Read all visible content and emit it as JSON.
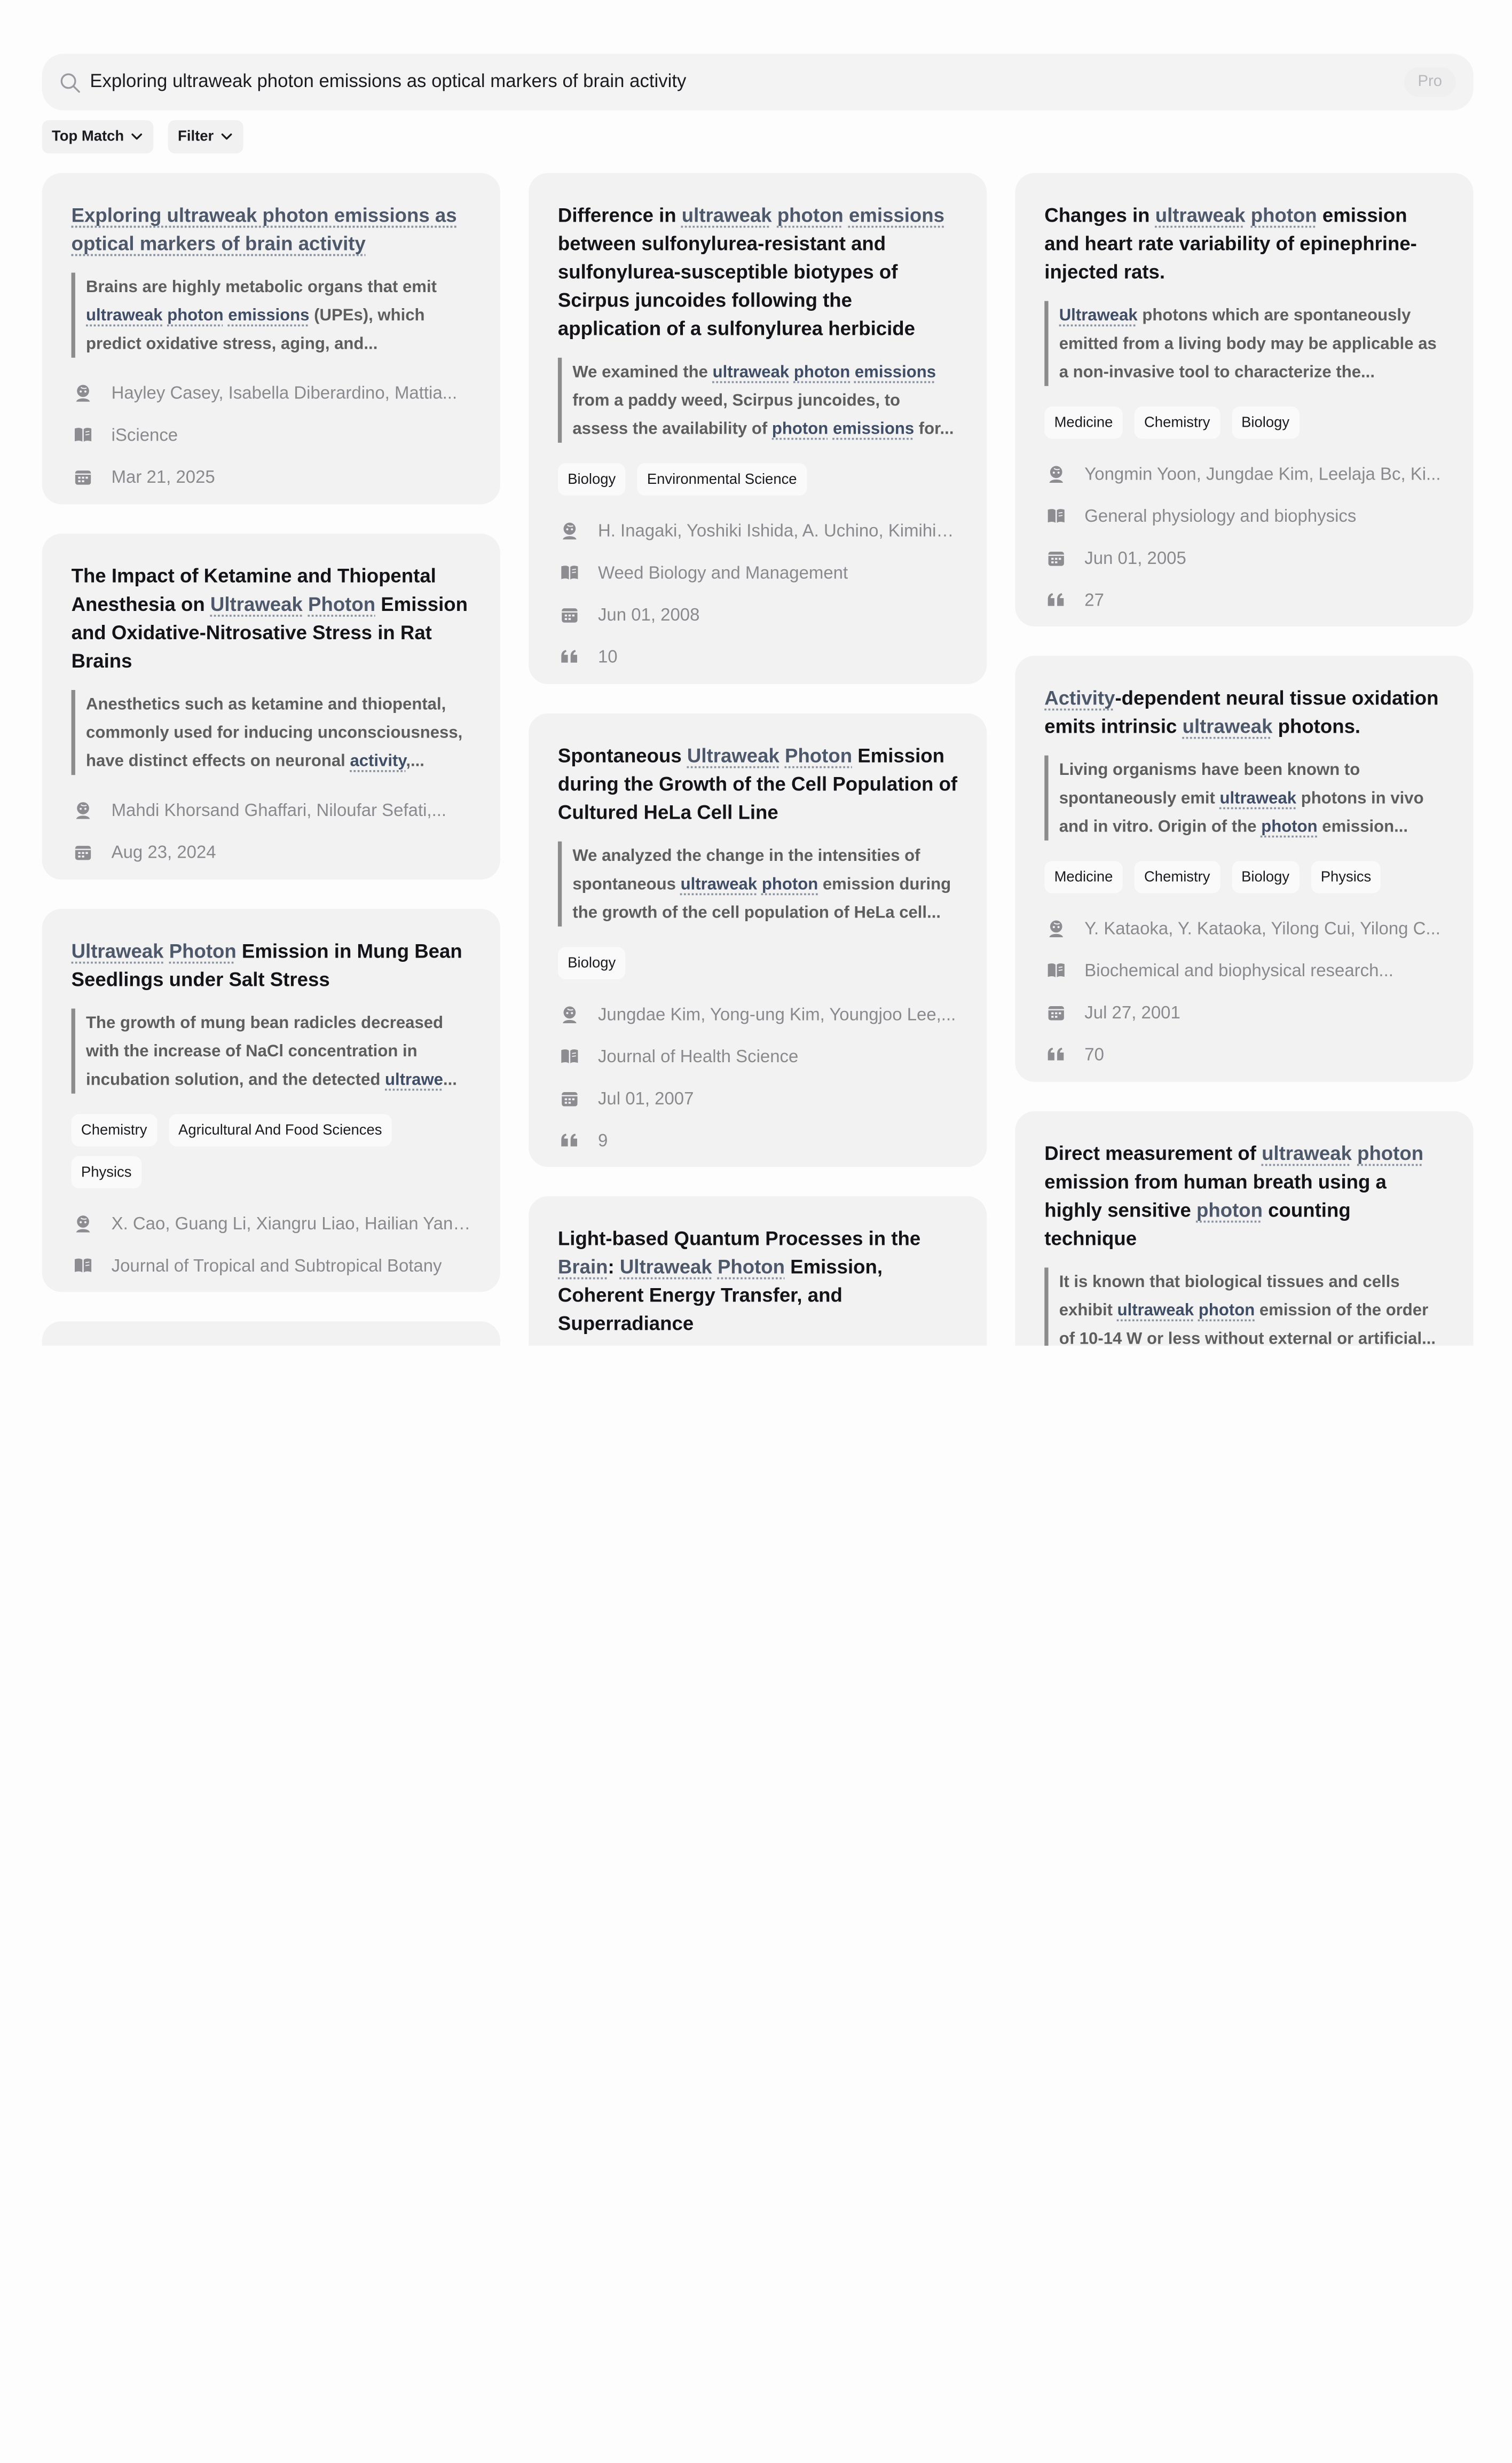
{
  "search": {
    "query": "Exploring ultraweak photon emissions as optical markers of brain activity",
    "pro_label": "Pro"
  },
  "controls": {
    "sort_label": "Top Match",
    "filter_label": "Filter"
  },
  "cards": [
    {
      "title_parts": [
        {
          "t": "Exploring ultraweak photon emissions as optical markers of brain activity",
          "h": true
        }
      ],
      "title_link": true,
      "abstract_parts": [
        {
          "t": "Brains are highly metabolic organs that emit "
        },
        {
          "t": "ultraweak",
          "h": true
        },
        {
          "t": " "
        },
        {
          "t": "photon",
          "h": true
        },
        {
          "t": " "
        },
        {
          "t": "emissions",
          "h": true
        },
        {
          "t": " (UPEs), which predict oxidative stress, aging, and..."
        }
      ],
      "tags": [],
      "authors": "Hayley Casey, Isabella Diberardino, Mattia...",
      "journal": "iScience",
      "date": "Mar 21, 2025",
      "citations": null
    },
    {
      "title_parts": [
        {
          "t": "The Impact of Ketamine and Thiopental Anesthesia on "
        },
        {
          "t": "Ultraweak",
          "h": true
        },
        {
          "t": " "
        },
        {
          "t": "Photon",
          "h": true
        },
        {
          "t": " Emission and Oxidative-Nitrosative Stress in Rat Brains"
        }
      ],
      "abstract_parts": [
        {
          "t": "Anesthetics such as ketamine and thiopental, commonly used for inducing unconsciousness, have distinct effects on neuronal "
        },
        {
          "t": "activity",
          "h": true
        },
        {
          "t": ",..."
        }
      ],
      "tags": [],
      "authors": "Mahdi Khorsand Ghaffari, Niloufar Sefati,...",
      "journal": null,
      "date": "Aug 23, 2024",
      "citations": null
    },
    {
      "title_parts": [
        {
          "t": "Ultraweak",
          "h": true
        },
        {
          "t": " "
        },
        {
          "t": "Photon",
          "h": true
        },
        {
          "t": " Emission in Mung Bean Seedlings under Salt Stress"
        }
      ],
      "abstract_parts": [
        {
          "t": "The growth of mung bean radicles decreased with the increase of NaCl concentration in incubation solution, and the detected "
        },
        {
          "t": "ultrawe",
          "h": true
        },
        {
          "t": "..."
        }
      ],
      "tags": [
        "Chemistry",
        "Agricultural And Food Sciences",
        "Physics"
      ],
      "authors": "X. Cao, Guang Li, Xiangru Liao, Hailian Yang...",
      "journal": "Journal of Tropical and Subtropical Botany",
      "date": null,
      "citations": null
    },
    {
      "title_parts": [
        {
          "t": "Difference in "
        },
        {
          "t": "ultraweak",
          "h": true
        },
        {
          "t": " "
        },
        {
          "t": "photon",
          "h": true
        },
        {
          "t": " "
        },
        {
          "t": "emissions",
          "h": true
        },
        {
          "t": " between sulfonylurea-resistant and sulfonylurea-susceptible biotypes of Scirpus juncoides following the application of a sulfonylurea herbicide"
        }
      ],
      "abstract_parts": [
        {
          "t": "We examined the "
        },
        {
          "t": "ultraweak",
          "h": true
        },
        {
          "t": " "
        },
        {
          "t": "photon",
          "h": true
        },
        {
          "t": " "
        },
        {
          "t": "emissions",
          "h": true
        },
        {
          "t": " from a paddy weed, Scirpus juncoides, to assess the availability of "
        },
        {
          "t": "photon",
          "h": true
        },
        {
          "t": " "
        },
        {
          "t": "emissions",
          "h": true
        },
        {
          "t": " for..."
        }
      ],
      "tags": [
        "Biology",
        "Environmental Science"
      ],
      "authors": "H. Inagaki, Yoshiki Ishida, A. Uchino, Kimihik...",
      "journal": "Weed Biology and Management",
      "date": "Jun 01, 2008",
      "citations": "10"
    },
    {
      "title_parts": [
        {
          "t": "Spontaneous "
        },
        {
          "t": "Ultraweak",
          "h": true
        },
        {
          "t": " "
        },
        {
          "t": "Photon",
          "h": true
        },
        {
          "t": " Emission during the Growth of the Cell Population of Cultured HeLa Cell Line"
        }
      ],
      "abstract_parts": [
        {
          "t": "We analyzed the change in the intensities of spontaneous "
        },
        {
          "t": "ultraweak",
          "h": true
        },
        {
          "t": " "
        },
        {
          "t": "photon",
          "h": true
        },
        {
          "t": " emission during the growth of the cell population of HeLa cell..."
        }
      ],
      "tags": [
        "Biology"
      ],
      "authors": "Jungdae Kim, Yong-ung Kim, Youngjoo Lee,...",
      "journal": "Journal of Health Science",
      "date": "Jul 01, 2007",
      "citations": "9"
    },
    {
      "title_parts": [
        {
          "t": "Light-based Quantum Processes in the "
        },
        {
          "t": "Brain",
          "h": true
        },
        {
          "t": ": "
        },
        {
          "t": "Ultraweak",
          "h": true
        },
        {
          "t": " "
        },
        {
          "t": "Photon",
          "h": true
        },
        {
          "t": " Emission, Coherent Energy Transfer, and Superradiance"
        }
      ],
      "abstract_parts": null,
      "tags": [],
      "authors": null,
      "journal": null,
      "date": null,
      "citations": null
    },
    {
      "title_parts": [
        {
          "t": "Changes in "
        },
        {
          "t": "ultraweak",
          "h": true
        },
        {
          "t": " "
        },
        {
          "t": "photon",
          "h": true
        },
        {
          "t": " emission and heart rate variability of epinephrine-injected rats."
        }
      ],
      "abstract_parts": [
        {
          "t": "Ultraweak",
          "h": true
        },
        {
          "t": " photons which are spontaneously emitted from a living body may be applicable as a non-invasive tool to characterize the..."
        }
      ],
      "tags": [
        "Medicine",
        "Chemistry",
        "Biology"
      ],
      "authors": "Yongmin Yoon, Jungdae Kim, Leelaja Bc, Ki...",
      "journal": "General physiology and biophysics",
      "date": "Jun 01, 2005",
      "citations": "27"
    },
    {
      "title_parts": [
        {
          "t": "Activity",
          "h": true
        },
        {
          "t": "-dependent neural tissue oxidation emits intrinsic "
        },
        {
          "t": "ultraweak",
          "h": true
        },
        {
          "t": " photons."
        }
      ],
      "abstract_parts": [
        {
          "t": "Living organisms have been known to spontaneously emit "
        },
        {
          "t": "ultraweak",
          "h": true
        },
        {
          "t": " photons in vivo and in vitro. Origin of the "
        },
        {
          "t": "photon",
          "h": true
        },
        {
          "t": " emission..."
        }
      ],
      "tags": [
        "Medicine",
        "Chemistry",
        "Biology",
        "Physics"
      ],
      "authors": "Y. Kataoka, Y. Kataoka, Yilong Cui, Yilong C...",
      "journal": "Biochemical and biophysical research...",
      "date": "Jul 27, 2001",
      "citations": "70"
    },
    {
      "title_parts": [
        {
          "t": "Direct measurement of "
        },
        {
          "t": "ultraweak",
          "h": true
        },
        {
          "t": " "
        },
        {
          "t": "photon",
          "h": true
        },
        {
          "t": " emission from human breath using a highly sensitive "
        },
        {
          "t": "photon",
          "h": true
        },
        {
          "t": " counting technique"
        }
      ],
      "abstract_parts": [
        {
          "t": "It is known that biological tissues and cells exhibit "
        },
        {
          "t": "ultraweak",
          "h": true
        },
        {
          "t": " "
        },
        {
          "t": "photon",
          "h": true
        },
        {
          "t": " emission of the order of 10-14 W or less without external or artificial..."
        }
      ],
      "tags": [],
      "authors": null,
      "journal": null,
      "date": null,
      "citations": null
    },
    {
      "title_parts": [],
      "abstract_parts": null,
      "tags": [],
      "authors": null,
      "journal": null,
      "date": null,
      "citations": null
    }
  ]
}
